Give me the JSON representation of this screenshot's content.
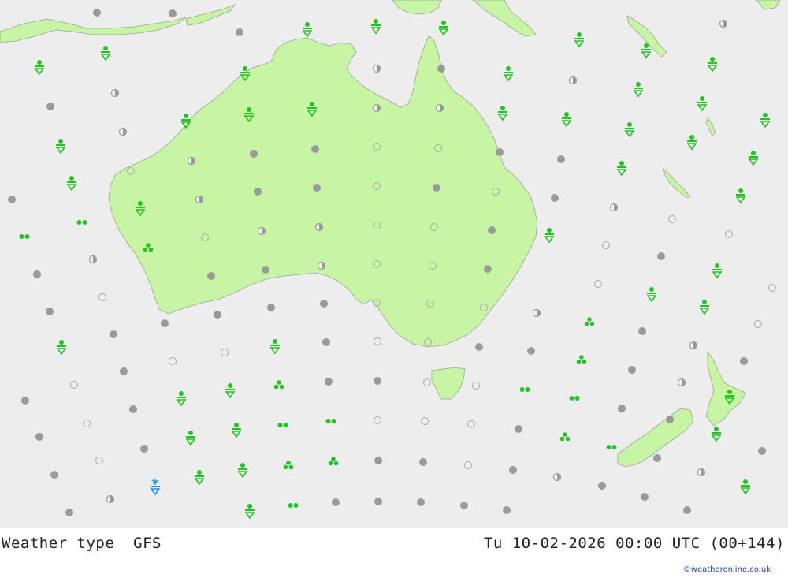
{
  "header": {
    "map_title": "Weather type  GFS",
    "datetime": "Tu 10-02-2026 00:00 UTC (00+144)",
    "credit": "©weatheronline.co.uk"
  },
  "colors": {
    "ocean": "#ededed",
    "land": "#c7f5a4",
    "coast": "#9aa29a",
    "rain": "#22c422",
    "snow": "#1e90ff",
    "cloud": "#9a9a9a"
  },
  "legend_symbols": [
    "rain-shower",
    "rain-cluster",
    "rain-drizzle",
    "snow-shower",
    "overcast",
    "partly-cloudy",
    "clear"
  ],
  "symbols": [
    [
      123,
      16,
      "overcast"
    ],
    [
      219,
      17,
      "overcast"
    ],
    [
      304,
      41,
      "overcast"
    ],
    [
      390,
      37,
      "rain-shower"
    ],
    [
      477,
      33,
      "rain-shower"
    ],
    [
      563,
      35,
      "rain-shower"
    ],
    [
      735,
      50,
      "rain-shower"
    ],
    [
      918,
      30,
      "partly-cloudy"
    ],
    [
      820,
      64,
      "rain-shower"
    ],
    [
      904,
      81,
      "rain-shower"
    ],
    [
      50,
      85,
      "rain-shower"
    ],
    [
      134,
      67,
      "rain-shower"
    ],
    [
      311,
      93,
      "rain-shower"
    ],
    [
      478,
      87,
      "partly-cloudy"
    ],
    [
      560,
      87,
      "overcast"
    ],
    [
      645,
      93,
      "rain-shower"
    ],
    [
      727,
      102,
      "partly-cloudy"
    ],
    [
      810,
      113,
      "rain-shower"
    ],
    [
      891,
      131,
      "rain-shower"
    ],
    [
      971,
      152,
      "rain-shower"
    ],
    [
      64,
      135,
      "overcast"
    ],
    [
      146,
      118,
      "partly-cloudy"
    ],
    [
      236,
      153,
      "rain-shower"
    ],
    [
      316,
      145,
      "rain-shower"
    ],
    [
      396,
      138,
      "rain-shower"
    ],
    [
      478,
      137,
      "partly-cloudy"
    ],
    [
      558,
      137,
      "partly-cloudy"
    ],
    [
      638,
      143,
      "rain-shower"
    ],
    [
      719,
      151,
      "rain-shower"
    ],
    [
      799,
      164,
      "rain-shower"
    ],
    [
      878,
      180,
      "rain-shower"
    ],
    [
      77,
      185,
      "rain-shower"
    ],
    [
      156,
      167,
      "partly-cloudy"
    ],
    [
      243,
      204,
      "partly-cloudy"
    ],
    [
      322,
      195,
      "overcast"
    ],
    [
      400,
      189,
      "overcast"
    ],
    [
      478,
      186,
      "clear"
    ],
    [
      556,
      188,
      "clear"
    ],
    [
      634,
      193,
      "overcast"
    ],
    [
      712,
      202,
      "overcast"
    ],
    [
      789,
      213,
      "rain-shower"
    ],
    [
      956,
      200,
      "rain-shower"
    ],
    [
      91,
      232,
      "rain-shower"
    ],
    [
      166,
      217,
      "clear"
    ],
    [
      253,
      253,
      "partly-cloudy"
    ],
    [
      327,
      243,
      "overcast"
    ],
    [
      402,
      238,
      "overcast"
    ],
    [
      478,
      236,
      "clear"
    ],
    [
      554,
      238,
      "overcast"
    ],
    [
      629,
      243,
      "clear"
    ],
    [
      704,
      251,
      "overcast"
    ],
    [
      779,
      263,
      "partly-cloudy"
    ],
    [
      853,
      278,
      "clear"
    ],
    [
      940,
      248,
      "rain-shower"
    ],
    [
      15,
      253,
      "overcast"
    ],
    [
      104,
      282,
      "rain-drizzle"
    ],
    [
      178,
      264,
      "rain-shower"
    ],
    [
      260,
      301,
      "clear"
    ],
    [
      332,
      293,
      "partly-cloudy"
    ],
    [
      405,
      288,
      "partly-cloudy"
    ],
    [
      478,
      286,
      "clear"
    ],
    [
      551,
      288,
      "clear"
    ],
    [
      624,
      292,
      "overcast"
    ],
    [
      697,
      298,
      "rain-shower"
    ],
    [
      769,
      311,
      "clear"
    ],
    [
      925,
      297,
      "clear"
    ],
    [
      31,
      300,
      "rain-drizzle"
    ],
    [
      118,
      329,
      "partly-cloudy"
    ],
    [
      188,
      314,
      "rain-cluster"
    ],
    [
      268,
      350,
      "overcast"
    ],
    [
      337,
      342,
      "overcast"
    ],
    [
      408,
      337,
      "partly-cloudy"
    ],
    [
      478,
      335,
      "clear"
    ],
    [
      549,
      337,
      "clear"
    ],
    [
      619,
      341,
      "overcast"
    ],
    [
      839,
      325,
      "overcast"
    ],
    [
      910,
      343,
      "rain-shower"
    ],
    [
      47,
      348,
      "overcast"
    ],
    [
      130,
      377,
      "clear"
    ],
    [
      209,
      410,
      "overcast"
    ],
    [
      276,
      399,
      "overcast"
    ],
    [
      344,
      390,
      "overcast"
    ],
    [
      411,
      385,
      "overcast"
    ],
    [
      478,
      384,
      "clear"
    ],
    [
      546,
      385,
      "clear"
    ],
    [
      614,
      390,
      "clear"
    ],
    [
      681,
      397,
      "partly-cloudy"
    ],
    [
      759,
      360,
      "clear"
    ],
    [
      827,
      373,
      "rain-shower"
    ],
    [
      980,
      365,
      "clear"
    ],
    [
      63,
      395,
      "overcast"
    ],
    [
      144,
      424,
      "overcast"
    ],
    [
      219,
      458,
      "clear"
    ],
    [
      285,
      447,
      "clear"
    ],
    [
      349,
      439,
      "rain-shower"
    ],
    [
      414,
      434,
      "overcast"
    ],
    [
      479,
      433,
      "clear"
    ],
    [
      543,
      434,
      "clear"
    ],
    [
      608,
      440,
      "overcast"
    ],
    [
      674,
      445,
      "overcast"
    ],
    [
      748,
      408,
      "rain-cluster"
    ],
    [
      815,
      420,
      "overcast"
    ],
    [
      880,
      438,
      "partly-cloudy"
    ],
    [
      962,
      411,
      "clear"
    ],
    [
      78,
      440,
      "rain-shower"
    ],
    [
      157,
      471,
      "overcast"
    ],
    [
      94,
      488,
      "clear"
    ],
    [
      292,
      495,
      "rain-shower"
    ],
    [
      354,
      488,
      "rain-cluster"
    ],
    [
      417,
      484,
      "overcast"
    ],
    [
      479,
      483,
      "overcast"
    ],
    [
      542,
      485,
      "clear"
    ],
    [
      604,
      489,
      "clear"
    ],
    [
      666,
      494,
      "rain-drizzle"
    ],
    [
      738,
      456,
      "rain-cluster"
    ],
    [
      802,
      469,
      "overcast"
    ],
    [
      865,
      485,
      "partly-cloudy"
    ],
    [
      944,
      458,
      "overcast"
    ],
    [
      894,
      389,
      "rain-shower"
    ],
    [
      32,
      508,
      "overcast"
    ],
    [
      169,
      519,
      "overcast"
    ],
    [
      230,
      505,
      "rain-shower"
    ],
    [
      110,
      537,
      "clear"
    ],
    [
      300,
      545,
      "rain-shower"
    ],
    [
      359,
      539,
      "rain-drizzle"
    ],
    [
      420,
      534,
      "rain-drizzle"
    ],
    [
      479,
      533,
      "clear"
    ],
    [
      539,
      534,
      "clear"
    ],
    [
      598,
      538,
      "clear"
    ],
    [
      658,
      544,
      "overcast"
    ],
    [
      729,
      505,
      "rain-drizzle"
    ],
    [
      789,
      518,
      "overcast"
    ],
    [
      850,
      532,
      "overcast"
    ],
    [
      926,
      503,
      "rain-shower"
    ],
    [
      50,
      554,
      "overcast"
    ],
    [
      183,
      569,
      "overcast"
    ],
    [
      242,
      555,
      "rain-shower"
    ],
    [
      126,
      584,
      "clear"
    ],
    [
      308,
      596,
      "rain-shower"
    ],
    [
      366,
      590,
      "rain-cluster"
    ],
    [
      423,
      585,
      "rain-cluster"
    ],
    [
      480,
      584,
      "overcast"
    ],
    [
      537,
      586,
      "overcast"
    ],
    [
      594,
      590,
      "clear"
    ],
    [
      651,
      596,
      "overcast"
    ],
    [
      717,
      554,
      "rain-cluster"
    ],
    [
      776,
      567,
      "rain-drizzle"
    ],
    [
      834,
      581,
      "overcast"
    ],
    [
      909,
      550,
      "rain-shower"
    ],
    [
      967,
      572,
      "overcast"
    ],
    [
      69,
      602,
      "overcast"
    ],
    [
      197,
      618,
      "snow-shower"
    ],
    [
      253,
      605,
      "rain-shower"
    ],
    [
      140,
      633,
      "partly-cloudy"
    ],
    [
      317,
      648,
      "rain-shower"
    ],
    [
      372,
      641,
      "rain-drizzle"
    ],
    [
      426,
      637,
      "overcast"
    ],
    [
      480,
      636,
      "overcast"
    ],
    [
      534,
      637,
      "overcast"
    ],
    [
      589,
      641,
      "overcast"
    ],
    [
      643,
      647,
      "overcast"
    ],
    [
      707,
      605,
      "partly-cloudy"
    ],
    [
      764,
      616,
      "overcast"
    ],
    [
      818,
      630,
      "overcast"
    ],
    [
      890,
      599,
      "partly-cloudy"
    ],
    [
      946,
      617,
      "rain-shower"
    ],
    [
      88,
      650,
      "overcast"
    ],
    [
      872,
      647,
      "overcast"
    ]
  ]
}
